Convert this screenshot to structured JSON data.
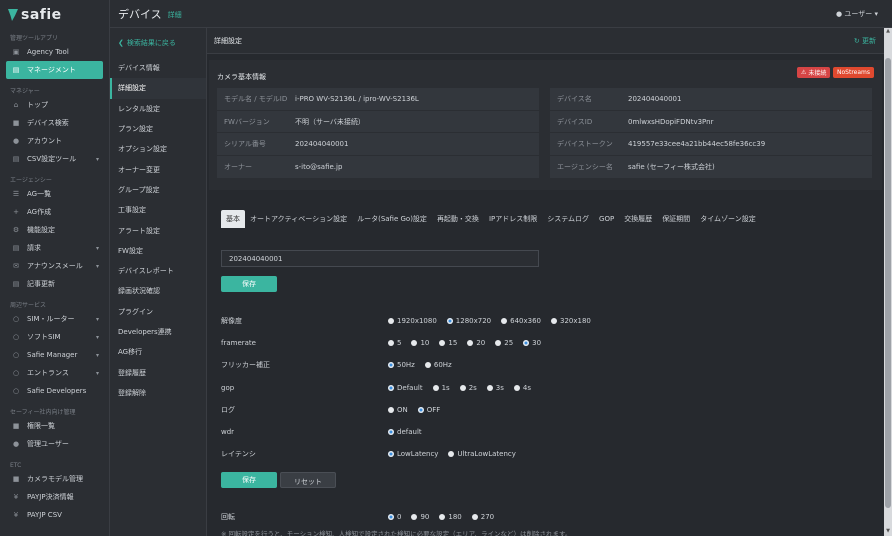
{
  "app": {
    "logo": "safie"
  },
  "sidebar": {
    "sections": [
      {
        "title": "管理ツールアプリ",
        "items": [
          {
            "label": "Agency Tool",
            "icon": "agency-icon",
            "arrow": false
          },
          {
            "label": "マネージメント",
            "icon": "management-icon",
            "arrow": false,
            "active": true
          }
        ]
      },
      {
        "title": "マネジャー",
        "items": [
          {
            "label": "トップ",
            "icon": "home-icon",
            "arrow": false
          },
          {
            "label": "デバイス検索",
            "icon": "camera-icon",
            "arrow": false
          },
          {
            "label": "アカウント",
            "icon": "user-icon",
            "arrow": false
          },
          {
            "label": "CSV設定ツール",
            "icon": "csv-icon",
            "arrow": true
          }
        ]
      },
      {
        "title": "エージェンシー",
        "items": [
          {
            "label": "AG一覧",
            "icon": "list-icon",
            "arrow": false
          },
          {
            "label": "AG作成",
            "icon": "plus-icon",
            "arrow": false
          },
          {
            "label": "機能設定",
            "icon": "settings-icon",
            "arrow": false
          },
          {
            "label": "請求",
            "icon": "invoice-icon",
            "arrow": true
          },
          {
            "label": "アナウンスメール",
            "icon": "mail-icon",
            "arrow": true
          },
          {
            "label": "記事更新",
            "icon": "article-icon",
            "arrow": false
          }
        ]
      },
      {
        "title": "周辺サービス",
        "items": [
          {
            "label": "SIM・ルーター",
            "icon": "circle-icon",
            "arrow": true
          },
          {
            "label": "ソフトSIM",
            "icon": "circle-icon",
            "arrow": true
          },
          {
            "label": "Safie Manager",
            "icon": "circle-icon",
            "arrow": true
          },
          {
            "label": "エントランス",
            "icon": "circle-icon",
            "arrow": true
          },
          {
            "label": "Safie Developers",
            "icon": "circle-icon",
            "arrow": false
          }
        ]
      },
      {
        "title": "セーフィー社内向け管理",
        "items": [
          {
            "label": "権限一覧",
            "icon": "lock-icon",
            "arrow": false
          },
          {
            "label": "管理ユーザー",
            "icon": "admin-user-icon",
            "arrow": false
          }
        ]
      },
      {
        "title": "ETC",
        "items": [
          {
            "label": "カメラモデル管理",
            "icon": "camera-model-icon",
            "arrow": false
          },
          {
            "label": "PAYJP決済情報",
            "icon": "yen-icon",
            "arrow": false
          },
          {
            "label": "PAYJP CSV",
            "icon": "yen-icon",
            "arrow": false
          }
        ]
      }
    ]
  },
  "header": {
    "title": "デバイス",
    "subtitle": "詳細",
    "user": "ユーザー"
  },
  "subnav": {
    "back": "検索結果に戻る",
    "items": [
      "デバイス情報",
      "詳細設定",
      "レンタル設定",
      "プラン設定",
      "オプション設定",
      "オーナー変更",
      "グループ設定",
      "工事設定",
      "アラート設定",
      "FW設定",
      "デバイスレポート",
      "録画状況確認",
      "プラグイン",
      "Developers連携",
      "AG移行",
      "登録履歴",
      "登録解除"
    ],
    "active_index": 1
  },
  "main": {
    "title": "詳細設定",
    "refresh": "更新"
  },
  "info": {
    "title": "カメラ基本情報",
    "badges": [
      "未接続",
      "NoStreams"
    ],
    "left": [
      {
        "k": "モデル名 / モデルID",
        "v": "i-PRO WV-S2136L / ipro-WV-S2136L"
      },
      {
        "k": "FWバージョン",
        "v": "不明（サーバ未接続）"
      },
      {
        "k": "シリアル番号",
        "v": "202404040001"
      },
      {
        "k": "オーナー",
        "v": "s-ito@safie.jp"
      }
    ],
    "right": [
      {
        "k": "デバイス名",
        "v": "202404040001"
      },
      {
        "k": "デバイスID",
        "v": "0mlwxsHDopiFDNtv3Pnr"
      },
      {
        "k": "デバイストークン",
        "v": "419557e33cee4a21bb44ec58fe36cc39"
      },
      {
        "k": "エージェンシー名",
        "v": "safie (セーフィー株式会社)"
      }
    ]
  },
  "tabs": [
    "基本",
    "オートアクティベーション設定",
    "ルータ(Safie Go)設定",
    "再起動・交換",
    "IPアドレス制限",
    "システムログ",
    "GOP",
    "交換履歴",
    "保証期間",
    "タイムゾーン設定"
  ],
  "basic": {
    "device_name_value": "202404040001",
    "save": "保存",
    "reset": "リセット",
    "settings": [
      {
        "label": "解像度",
        "options": [
          "1920x1080",
          "1280x720",
          "640x360",
          "320x180"
        ],
        "selected": 1
      },
      {
        "label": "framerate",
        "options": [
          "5",
          "10",
          "15",
          "20",
          "25",
          "30"
        ],
        "selected": 5
      },
      {
        "label": "フリッカー補正",
        "options": [
          "50Hz",
          "60Hz"
        ],
        "selected": 0
      },
      {
        "label": "gop",
        "options": [
          "Default",
          "1s",
          "2s",
          "3s",
          "4s"
        ],
        "selected": 0
      },
      {
        "label": "ログ",
        "options": [
          "ON",
          "OFF"
        ],
        "selected": 1
      },
      {
        "label": "wdr",
        "options": [
          "default"
        ],
        "selected": 0
      },
      {
        "label": "レイテンシ",
        "options": [
          "LowLatency",
          "UltraLowLatency"
        ],
        "selected": 0
      }
    ],
    "rotation": {
      "label": "回転",
      "options": [
        "0",
        "90",
        "180",
        "270"
      ],
      "selected": 0
    },
    "note": "※ 回転設定を行うと、モーション検知、人検知で設定された検知に必要な設定（エリア、ラインなど）は削除されます。"
  }
}
